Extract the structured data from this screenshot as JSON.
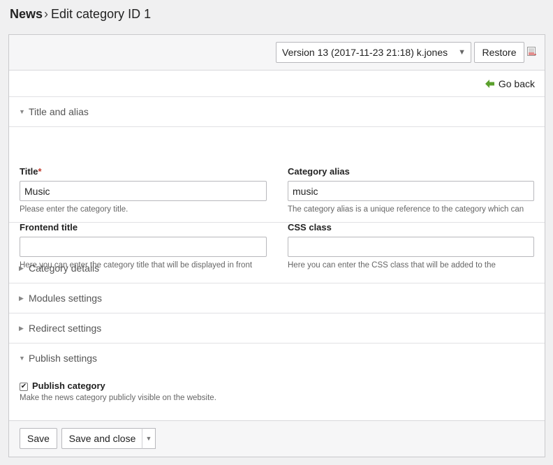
{
  "header": {
    "breadcrumb_root": "News",
    "separator": "›",
    "title": "Edit category ID 1"
  },
  "version_bar": {
    "selected_version": "Version 13 (2017-11-23 21:18) k.jones",
    "restore_label": "Restore"
  },
  "nav": {
    "go_back_label": "Go back"
  },
  "sections": {
    "title_alias": {
      "label": "Title and alias",
      "title_label": "Title",
      "required_mark": "*",
      "title_value": "Music",
      "title_help": "Please enter the category title.",
      "alias_label": "Category alias",
      "alias_value": "music",
      "alias_help": "The category alias is a unique reference to the category which can",
      "frontend_title_label": "Frontend title",
      "frontend_title_value": "",
      "frontend_title_help": "Here you can enter the category title that will be displayed in front",
      "css_class_label": "CSS class",
      "css_class_value": "",
      "css_class_help": "Here you can enter the CSS class that will be added to the"
    },
    "category_details": {
      "label": "Category details"
    },
    "modules_settings": {
      "label": "Modules settings"
    },
    "redirect_settings": {
      "label": "Redirect settings"
    },
    "publish_settings": {
      "label": "Publish settings",
      "publish_label": "Publish category",
      "publish_help": "Make the news category publicly visible on the website."
    }
  },
  "footer": {
    "save_label": "Save",
    "save_close_label": "Save and close"
  }
}
